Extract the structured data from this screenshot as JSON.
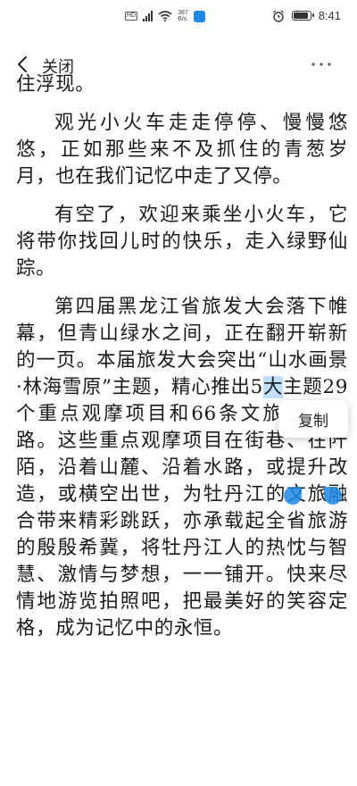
{
  "status_bar": {
    "hd_badge": "HD",
    "net_speed_value": "387",
    "net_speed_unit": "B/s",
    "time": "8:41",
    "battery_level": 0.9,
    "icons": [
      "sim-hd-icon",
      "signal-icon",
      "wifi-icon",
      "app-notification-icon",
      "alarm-icon",
      "battery-icon"
    ]
  },
  "nav": {
    "close_label": "关闭",
    "icons": [
      "back-chevron-icon",
      "more-dots-icon"
    ]
  },
  "article": {
    "partial_top_line": "住浮现。",
    "paragraphs": [
      "观光小火车走走停停、慢慢悠悠，正如那些来不及抓住的青葱岁月，也在我们记忆中走了又停。",
      "有空了，欢迎来乘坐小火车，它将带你找回儿时的快乐，走入绿野仙踪。"
    ],
    "last_paragraph": {
      "before_selection": "第四届黑龙江省旅发大会落下帷幕，但青山绿水之间，正在翻开崭新的一页。本届旅发大会突出“山水画景·林海雪原”主题，精心推出5",
      "selected_text": "大",
      "after_selection": "主题29个重点观摩项目和66条文旅精品线路。这些重点观摩项目在街巷、在阡陌，沿着山麓、沿着水路，或提升改造，或横空出世，为牡丹江的文旅融合带来精彩跳跃，亦承载起全省旅游的殷殷希冀，将牡丹江人的热忱与智慧、激情与梦想，一一铺开。快来尽情地游览拍照吧，把最美好的笑容定格，成为记忆中的永恒。"
    }
  },
  "selection_menu": {
    "copy_label": "复制"
  },
  "colors": {
    "selection_highlight": "#bfe0ff",
    "handle": "#1e88e5",
    "text": "#1a1a1a"
  }
}
